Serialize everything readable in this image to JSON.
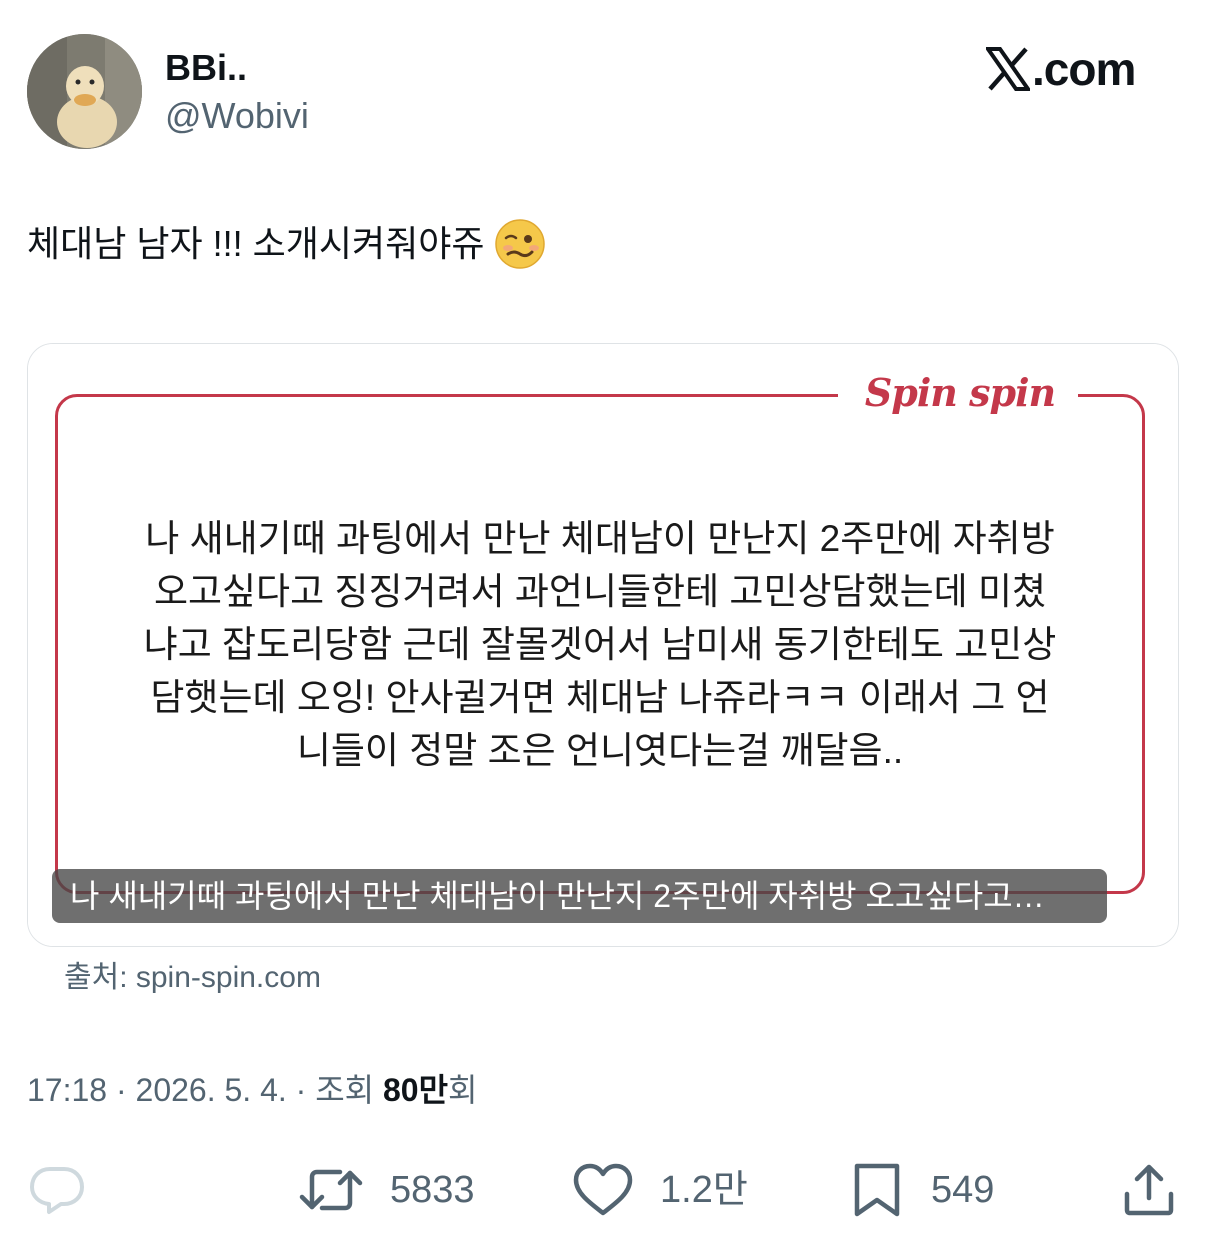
{
  "author": {
    "display_name": "BBi..",
    "handle": "@Wobivi",
    "avatar_icon": "duck-avatar"
  },
  "site": {
    "x_glyph": "𝕏",
    "domain": ".com"
  },
  "tweet": {
    "text": "체대남 남자 !!! 소개시켜줘야쥬",
    "emoji_icon": "woozy-face-emoji"
  },
  "card": {
    "brand": "Spin spin",
    "story_lines": [
      "나 새내기때 과팅에서 만난 체대남이 만난지 2주만에 자취방",
      "오고싶다고 징징거려서 과언니들한테 고민상담했는데 미쳤",
      "냐고 잡도리당함 근데 잘몰겟어서 남미새 동기한테도 고민상",
      "담햇는데 오잉! 안사귈거면 체대남 나쥬라ㅋㅋ 이래서 그 언",
      "니들이 정말 조은 언니엿다는걸 깨달음.."
    ],
    "caption": "나 새내기때 과팅에서 만난 체대남이 만난지 2주만에 자취방 오고싶다고…",
    "source": "출처: spin-spin.com",
    "accent_color": "#c4384a"
  },
  "meta": {
    "time": "17:18",
    "sep1": " · ",
    "date": "2026. 5. 4.",
    "sep2": " · ",
    "views_label": "조회 ",
    "views_count": "80만",
    "views_suffix": "회"
  },
  "actions": {
    "reply_icon": "reply-icon",
    "retweet_icon": "retweet-icon",
    "retweet_count": "5833",
    "like_icon": "heart-icon",
    "like_count": "1.2만",
    "bookmark_icon": "bookmark-icon",
    "bookmark_count": "549",
    "share_icon": "share-icon"
  }
}
